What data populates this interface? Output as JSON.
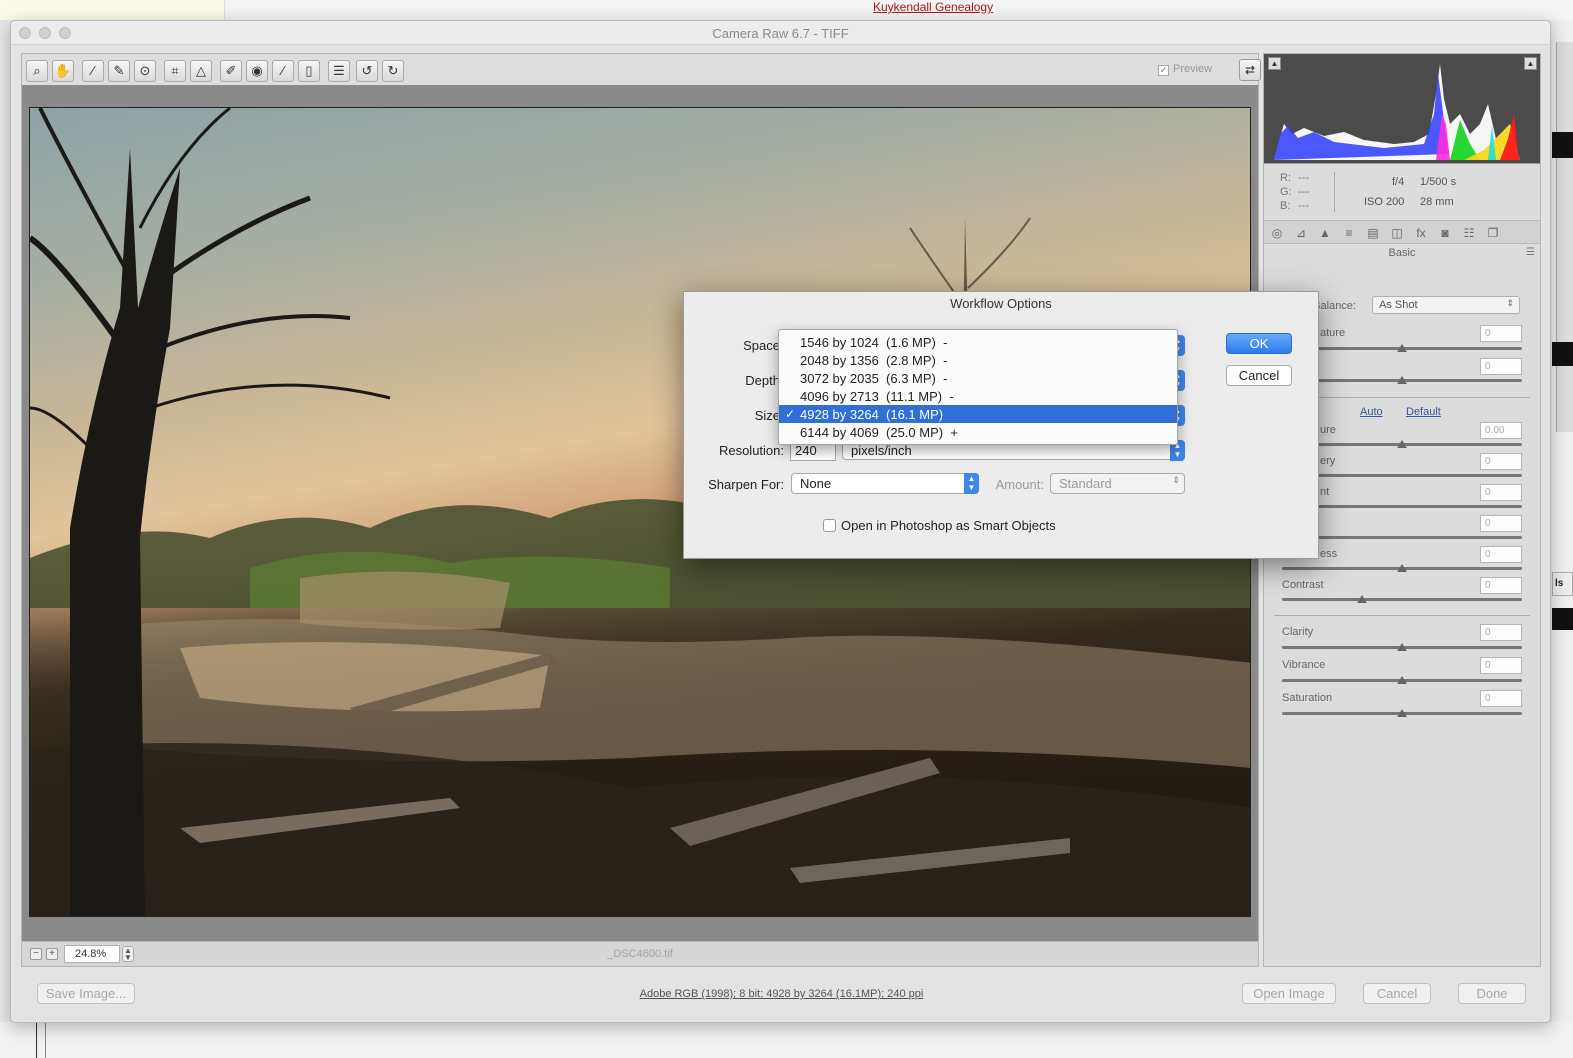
{
  "browser": {
    "link": "Kuykendall Genealogy"
  },
  "window": {
    "title": "Camera Raw 6.7  -  TIFF"
  },
  "toolbar": {
    "tools": [
      "zoom-icon",
      "hand-icon",
      "white-balance-icon",
      "color-sampler-icon",
      "target-adjust-icon",
      "crop-icon",
      "straighten-icon",
      "spot-removal-icon",
      "red-eye-icon",
      "adjustment-brush-icon",
      "graduated-filter-icon",
      "preferences-icon",
      "rotate-left-icon",
      "rotate-right-icon"
    ],
    "preview_label": "Preview",
    "preview_checked": "✓"
  },
  "status": {
    "zoom": "24.8%",
    "filename": "_DSC4600.tif"
  },
  "histogram": {
    "readout": {
      "r_label": "R:",
      "g_label": "G:",
      "b_label": "B:",
      "r": "---",
      "g": "---",
      "b": "---"
    },
    "aperture": "f/4",
    "shutter": "1/500 s",
    "iso": "ISO 200",
    "focal": "28 mm"
  },
  "basic_panel": {
    "title": "Basic",
    "white_balance_label": "White Balance:",
    "white_balance_value": "As Shot",
    "temperature_label": "ature",
    "auto": "Auto",
    "default": "Default",
    "exposure_label": "ure",
    "exposure_value": "0.00",
    "recovery_label": "ery",
    "fill_label": "nt",
    "darkness_label": "ess",
    "contrast_label": "Contrast",
    "clarity_label": "Clarity",
    "vibrance_label": "Vibrance",
    "saturation_label": "Saturation",
    "zero": "0"
  },
  "bottom": {
    "save": "Save Image...",
    "workflow": "Adobe RGB (1998); 8 bit; 4928 by 3264 (16.1MP); 240 ppi",
    "open": "Open Image",
    "cancel": "Cancel",
    "done": "Done"
  },
  "dialog": {
    "title": "Workflow Options",
    "space_label": "Space",
    "depth_label": "Depth",
    "size_label": "Size",
    "resolution_label": "Resolution:",
    "resolution_value": "240",
    "resolution_unit": "pixels/inch",
    "sharpen_label": "Sharpen For:",
    "sharpen_value": "None",
    "amount_label": "Amount:",
    "amount_value": "Standard",
    "smart_objects_label": "Open in Photoshop as Smart Objects",
    "ok": "OK",
    "cancel": "Cancel",
    "size_options": [
      "1546 by 1024  (1.6 MP)  -",
      "2048 by 1356  (2.8 MP)  -",
      "3072 by 2035  (6.3 MP)  -",
      "4096 by 2713  (11.1 MP)  -",
      "4928 by 3264  (16.1 MP)",
      "6144 by 4069  (25.0 MP)  +"
    ],
    "selected_check": "✓"
  },
  "colors": {
    "accent": "#2f6fd6",
    "ok_button": "#2d7cec",
    "link": "#b01818"
  }
}
